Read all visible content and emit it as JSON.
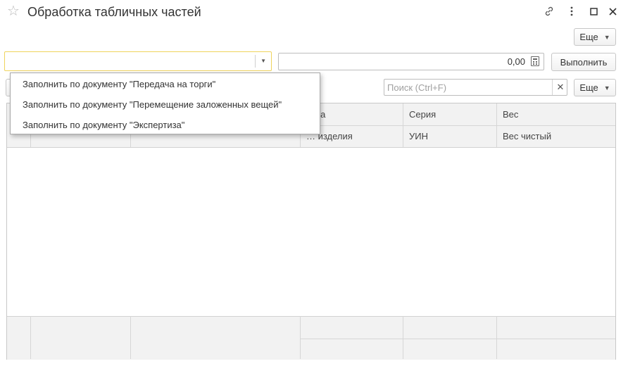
{
  "window": {
    "title": "Обработка табличных частей",
    "icons": [
      "star-icon",
      "link-icon",
      "kebab-menu-icon",
      "maximize-icon",
      "close-icon"
    ]
  },
  "toolbar": {
    "more_label_top": "Еще",
    "execute_label": "Выполнить",
    "more_label_table": "Еще"
  },
  "inputs": {
    "combo_value": "",
    "amount_value": "0,00",
    "search_placeholder": "Поиск (Ctrl+F)"
  },
  "dropdown": {
    "items": [
      "Заполнить по документу \"Передача на торги\"",
      "Заполнить по документу \"Перемещение заложенных вещей\"",
      "Заполнить по документу \"Экспертиза\""
    ]
  },
  "table": {
    "header_row1": {
      "probe": "…ба",
      "series": "Серия",
      "weight": "Вес"
    },
    "header_row2": {
      "item": "… изделия",
      "uin": "УИН",
      "net_weight": "Вес чистый"
    }
  },
  "colors": {
    "accent_border": "#efd35c",
    "header_bg": "#f2f2f2"
  }
}
